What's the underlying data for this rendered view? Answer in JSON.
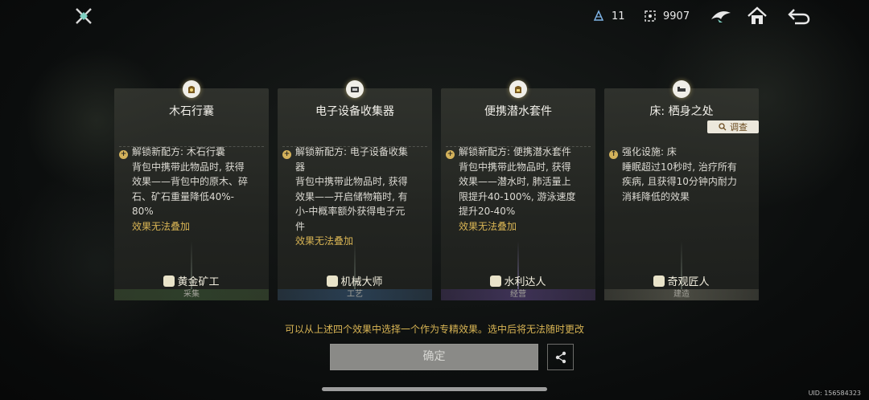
{
  "topbar": {
    "resource1_value": "11",
    "resource2_value": "9907"
  },
  "cards": [
    {
      "title": "木石行囊",
      "lines": [
        "解锁新配方: 木石行囊",
        "背包中携带此物品时, 获得",
        "效果——背包中的原木、碎",
        "石、矿石重量降低40%-",
        "80%"
      ],
      "note": "效果无法叠加",
      "role": "黄金矿工",
      "category": "采集"
    },
    {
      "title": "电子设备收集器",
      "lines": [
        "解锁新配方: 电子设备收集",
        "器",
        "背包中携带此物品时, 获得",
        "效果——开启储物箱时, 有",
        "小-中概率额外获得电子元",
        "件"
      ],
      "note": "效果无法叠加",
      "role": "机械大师",
      "category": "工艺"
    },
    {
      "title": "便携潜水套件",
      "lines": [
        "解锁新配方: 便携潜水套件",
        "背包中携带此物品时, 获得",
        "效果——潜水时, 肺活量上",
        "限提升40-100%, 游泳速度",
        "提升20-40%"
      ],
      "note": "效果无法叠加",
      "role": "水利达人",
      "category": "经营"
    },
    {
      "title": "床: 栖身之处",
      "inspect_label": "调查",
      "lines": [
        "强化设施: 床",
        "睡眠超过10秒时, 治疗所有",
        "疾病, 且获得10分钟内耐力",
        "消耗降低的效果"
      ],
      "role": "奇观匠人",
      "category": "建造"
    }
  ],
  "hint": "可以从上述四个效果中选择一个作为专精效果。选中后将无法随时更改",
  "confirm_label": "确定",
  "uid": "UID: 156584323",
  "colors": {
    "gold": "#d8b454",
    "confirm_bg": "#8a8a87"
  }
}
